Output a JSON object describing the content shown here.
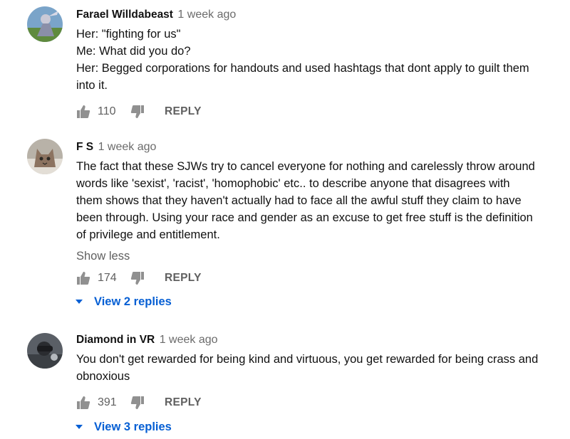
{
  "colors": {
    "link_blue": "#065fd4",
    "secondary_text": "#606060",
    "primary_text": "#111111"
  },
  "comments": [
    {
      "author": "Farael Willdabeast",
      "time": "1 week ago",
      "lines": [
        "Her: \"fighting for us\"",
        "Me: What did you do?",
        "Her: Begged corporations for handouts and used hashtags that dont apply to guilt them",
        "into it."
      ],
      "likes": "110",
      "reply_label": "REPLY",
      "like_icon": "thumbs-up-icon",
      "dislike_icon": "thumbs-down-icon"
    },
    {
      "author": "F S",
      "time": "1 week ago",
      "lines": [
        "The fact that these SJWs try to cancel everyone for nothing and carelessly throw around",
        "words like 'sexist', 'racist', 'homophobic' etc.. to describe anyone that disagrees with",
        "them shows that they haven't actually had to face all the awful stuff they claim to have",
        "been through. Using your race and gender as an excuse to get free stuff is the definition",
        "of privilege and entitlement."
      ],
      "show_less": "Show less",
      "likes": "174",
      "reply_label": "REPLY",
      "view_replies": "View 2 replies"
    },
    {
      "author": "Diamond in VR",
      "time": "1 week ago",
      "lines": [
        "You don't get rewarded for being kind and virtuous, you get rewarded for being crass and",
        "obnoxious"
      ],
      "likes": "391",
      "reply_label": "REPLY",
      "view_replies": "View 3 replies"
    }
  ]
}
